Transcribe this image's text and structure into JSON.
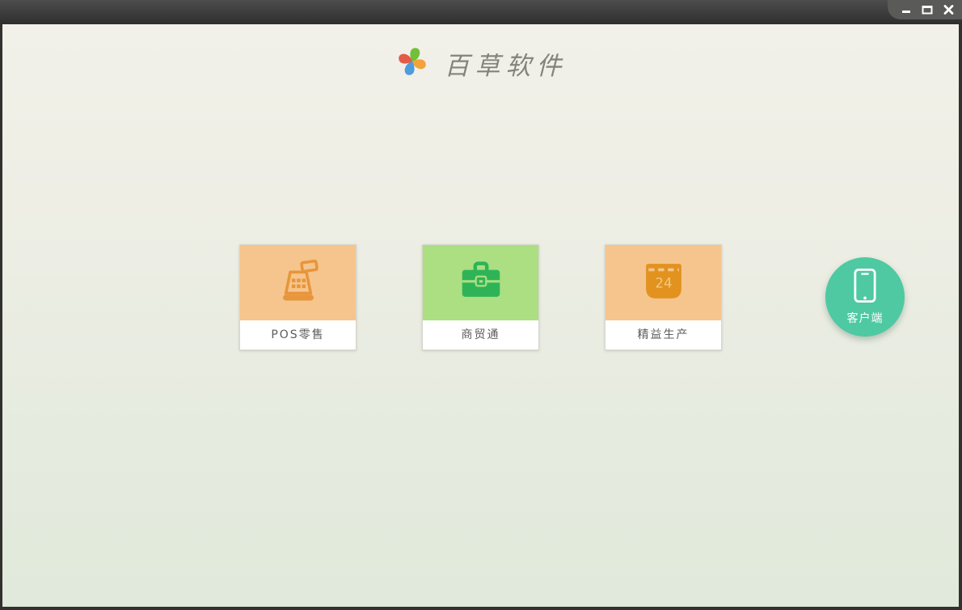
{
  "titlebar": {
    "controls": [
      {
        "icon": "minimize-icon"
      },
      {
        "icon": "maximize-icon"
      },
      {
        "icon": "close-icon"
      }
    ]
  },
  "brand": {
    "logo_icon": "pinwheel-logo-icon",
    "title": "百草软件"
  },
  "products": [
    {
      "label": "POS零售",
      "icon": "cash-register-icon",
      "tile_color": "#f6c58d",
      "icon_color": "#e8963b"
    },
    {
      "label": "商贸通",
      "icon": "briefcase-icon",
      "tile_color": "#abdf82",
      "icon_color": "#2eb457"
    },
    {
      "label": "精益生产",
      "icon": "calendar-icon",
      "calendar_day": "24",
      "tile_color": "#f6c58d",
      "icon_color": "#e2921e"
    }
  ],
  "client_button": {
    "label": "客户端",
    "icon": "smartphone-icon",
    "color": "#4ec9a2"
  },
  "colors": {
    "frame": "#31312e",
    "titlebar_top": "#4d4d4d",
    "titlebar_bottom": "#2e2e2e",
    "background_top": "#f2f1e9",
    "background_bottom": "#e0e9db",
    "brand_text": "#83837b",
    "card_label_text": "#5c5c5a"
  }
}
